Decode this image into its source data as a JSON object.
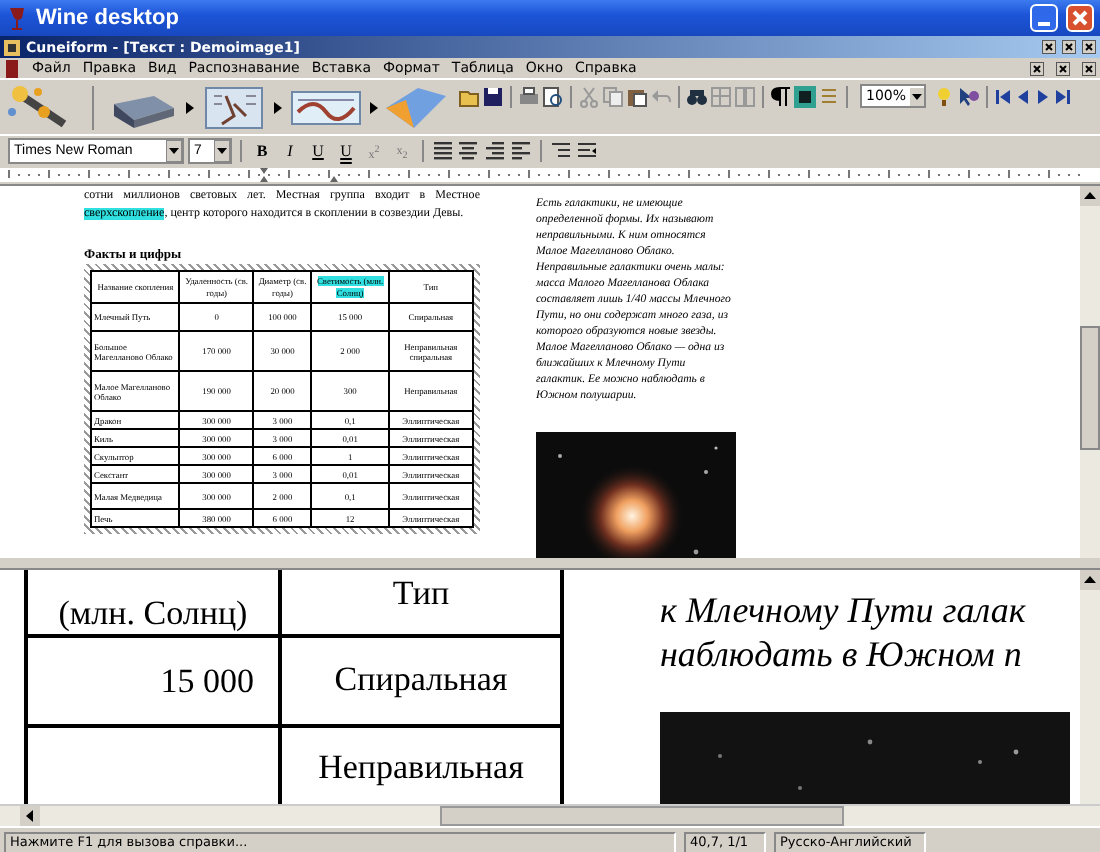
{
  "window": {
    "title": "Wine desktop"
  },
  "app": {
    "title": "Cuneiform - [Текст : Demoimage1]"
  },
  "menu": [
    "Файл",
    "Правка",
    "Вид",
    "Распознавание",
    "Вставка",
    "Формат",
    "Таблица",
    "Окно",
    "Справка"
  ],
  "toolbar": {
    "zoom": "100%"
  },
  "format_bar": {
    "font": "Times New Roman",
    "size": "7",
    "buttons": [
      {
        "kind": "bold",
        "label": "B"
      },
      {
        "kind": "italic",
        "label": "I"
      },
      {
        "kind": "underline",
        "label": "U"
      },
      {
        "kind": "double-underline",
        "label": "U"
      },
      {
        "kind": "superscript",
        "label": "x$^{2}$"
      },
      {
        "kind": "subscript",
        "label": "x$_{2}$"
      }
    ]
  },
  "document": {
    "paragraph": [
      {
        "text": "сотни миллионов световых лет. Местная группа входит в Местное ",
        "highlighted": false
      },
      {
        "text": "сверхскопление",
        "highlighted": true
      },
      {
        "text": ", центр которого находится в скоплении в созвездии Девы.",
        "highlighted": false
      }
    ],
    "table_title": "Факты и цифры",
    "table": {
      "columns": [
        {
          "label": "Название скопления",
          "highlighted": false
        },
        {
          "label": "Удаленность (св. годы)",
          "highlighted": false
        },
        {
          "label": "Диаметр (св. годы)",
          "highlighted": false
        },
        {
          "label": "Светимость (млн. Солнц)",
          "highlighted": true
        },
        {
          "label": "Тип",
          "highlighted": false
        }
      ],
      "rows": [
        [
          "Млечный Путь",
          "0",
          "100 000",
          "15 000",
          "Спиральная"
        ],
        [
          "Большое Магелланово Облако",
          "170 000",
          "30 000",
          "2 000",
          "Неправильная спиральная"
        ],
        [
          "Малое Магелланово Облако",
          "190 000",
          "20 000",
          "300",
          "Неправильная"
        ],
        [
          "Дракон",
          "300 000",
          "3 000",
          "0,1",
          "Эллиптическая"
        ],
        [
          "Киль",
          "300 000",
          "3 000",
          "0,01",
          "Эллиптическая"
        ],
        [
          "Скульптор",
          "300 000",
          "6 000",
          "1",
          "Эллиптическая"
        ],
        [
          "Секстант",
          "300 000",
          "3 000",
          "0,01",
          "Эллиптическая"
        ],
        [
          "Малая Медведица",
          "300 000",
          "2 000",
          "0,1",
          "Эллиптическая"
        ],
        [
          "Печь",
          "380 000",
          "6 000",
          "12",
          "Эллиптическая"
        ]
      ]
    },
    "side_text": "Есть галактики, не имеющие определенной формы. Их называют неправильными. К ним относятся Малое Магелланово Облако. Неправильные галактики очень малы: масса Малого Магелланова Облака составляет лишь 1/40 массы Млечного Пути, но они содержат много газа, из которого образуются новые звезды. Малое Магелланово Облако — одна из ближайших к Млечному Пути галактик. Ее можно наблюдать в Южном полушарии."
  },
  "zoom_view": {
    "luminosity": [
      "(млн. Солнц)",
      "15 000"
    ],
    "type": [
      "Тип",
      "Спиральная",
      "Неправильная"
    ],
    "text": [
      "к Млечному Пути галак",
      "наблюдать в Южном п"
    ]
  },
  "status_bar": {
    "hint": "Нажмите F1 для вызова справки...",
    "position": "40,7, 1/1",
    "language": "Русско-Английский"
  }
}
